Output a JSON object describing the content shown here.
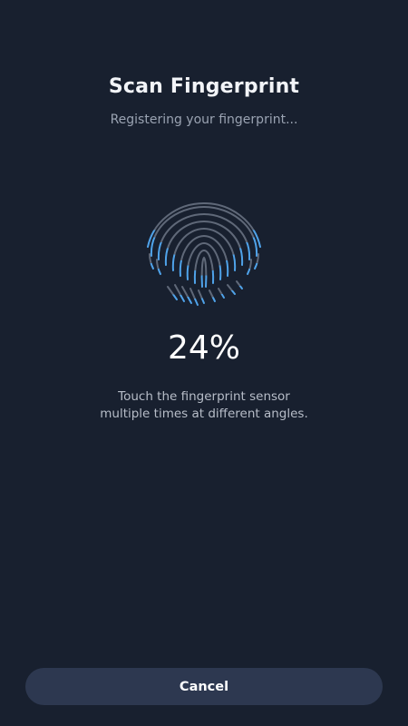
{
  "header": {
    "title": "Scan Fingerprint",
    "subtitle": "Registering your fingerprint..."
  },
  "scan": {
    "icon": "fingerprint-icon",
    "progress_fraction": 0.24,
    "percent_text": "24%",
    "instructions_line1": "Touch the fingerprint sensor",
    "instructions_line2": "multiple times at different angles."
  },
  "footer": {
    "cancel_label": "Cancel"
  },
  "colors": {
    "background": "#18202f",
    "ridge": "#5f6878",
    "ridge_scanned": "#4fa3ea",
    "button": "#2d3850"
  }
}
